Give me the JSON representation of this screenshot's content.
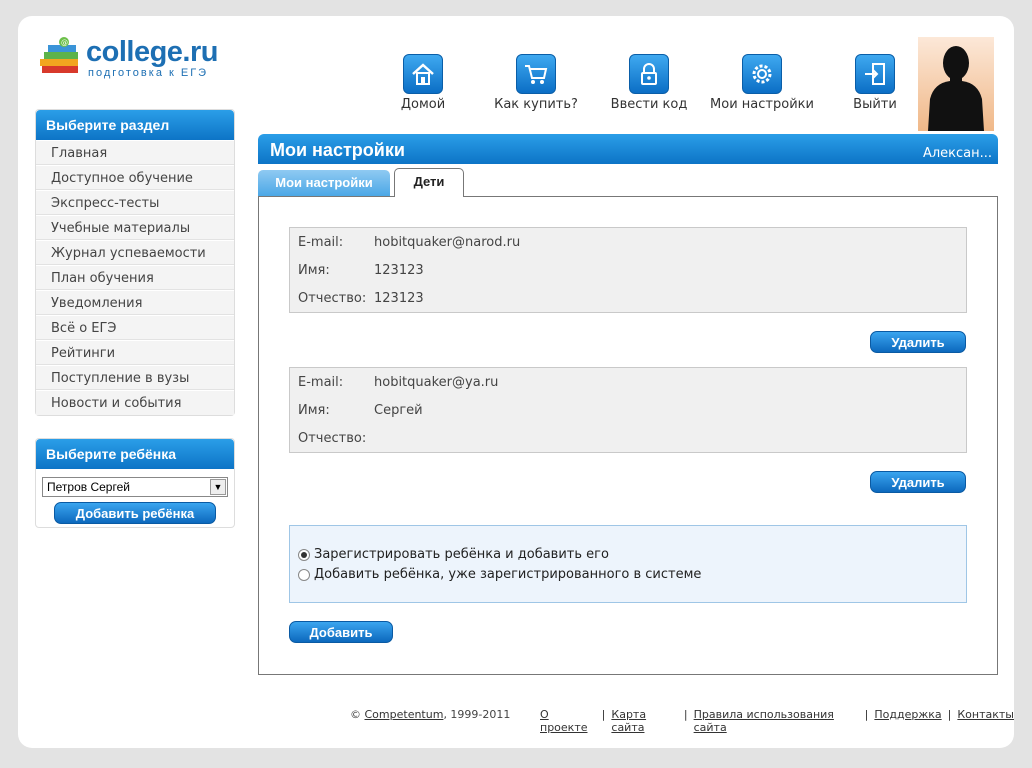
{
  "logo": {
    "brand": "college.ru",
    "tagline": "подготовка к ЕГЭ"
  },
  "topnav": [
    {
      "label": "Домой",
      "icon": "home-icon"
    },
    {
      "label": "Как купить?",
      "icon": "cart-icon"
    },
    {
      "label": "Ввести код",
      "icon": "lock-icon"
    },
    {
      "label": "Мои настройки",
      "icon": "gear-icon"
    },
    {
      "label": "Выйти",
      "icon": "exit-icon"
    }
  ],
  "sidebar": {
    "section_title": "Выберите раздел",
    "items": [
      {
        "label": "Главная"
      },
      {
        "label": "Доступное обучение"
      },
      {
        "label": "Экспресс-тесты"
      },
      {
        "label": "Учебные материалы"
      },
      {
        "label": "Журнал успеваемости"
      },
      {
        "label": "План обучения"
      },
      {
        "label": "Уведомления"
      },
      {
        "label": "Всё о ЕГЭ"
      },
      {
        "label": "Рейтинги"
      },
      {
        "label": "Поступление в вузы"
      },
      {
        "label": "Новости и события"
      }
    ],
    "child_title": "Выберите ребёнка",
    "child_selected": "Петров Сергей",
    "add_child_label": "Добавить ребёнка"
  },
  "main": {
    "title": "Мои настройки",
    "user": "Алексан...",
    "tabs": [
      {
        "label": "Мои настройки",
        "active": false
      },
      {
        "label": "Дети",
        "active": true
      }
    ],
    "children": [
      {
        "email_label": "E-mail:",
        "email": "hobitquaker@narod.ru",
        "name_label": "Имя:",
        "name": "123123",
        "patronymic_label": "Отчество:",
        "patronymic": "123123",
        "delete_label": "Удалить"
      },
      {
        "email_label": "E-mail:",
        "email": "hobitquaker@ya.ru",
        "name_label": "Имя:",
        "name": "Сергей",
        "patronymic_label": "Отчество:",
        "patronymic": "",
        "delete_label": "Удалить"
      }
    ],
    "options": [
      {
        "label": "Зарегистрировать ребёнка и добавить его",
        "selected": true
      },
      {
        "label": "Добавить ребёнка, уже зарегистрированного в системе",
        "selected": false
      }
    ],
    "add_label": "Добавить"
  },
  "footer": {
    "copyright_prefix": "©",
    "company": "Competentum",
    "years": ", 1999-2011",
    "links": [
      "О проекте",
      "Карта сайта",
      "Правила использования сайта",
      "Поддержка",
      "Контакты"
    ]
  },
  "colors": {
    "accent": "#1d7fd0",
    "header_blue": "#0d74c6"
  }
}
